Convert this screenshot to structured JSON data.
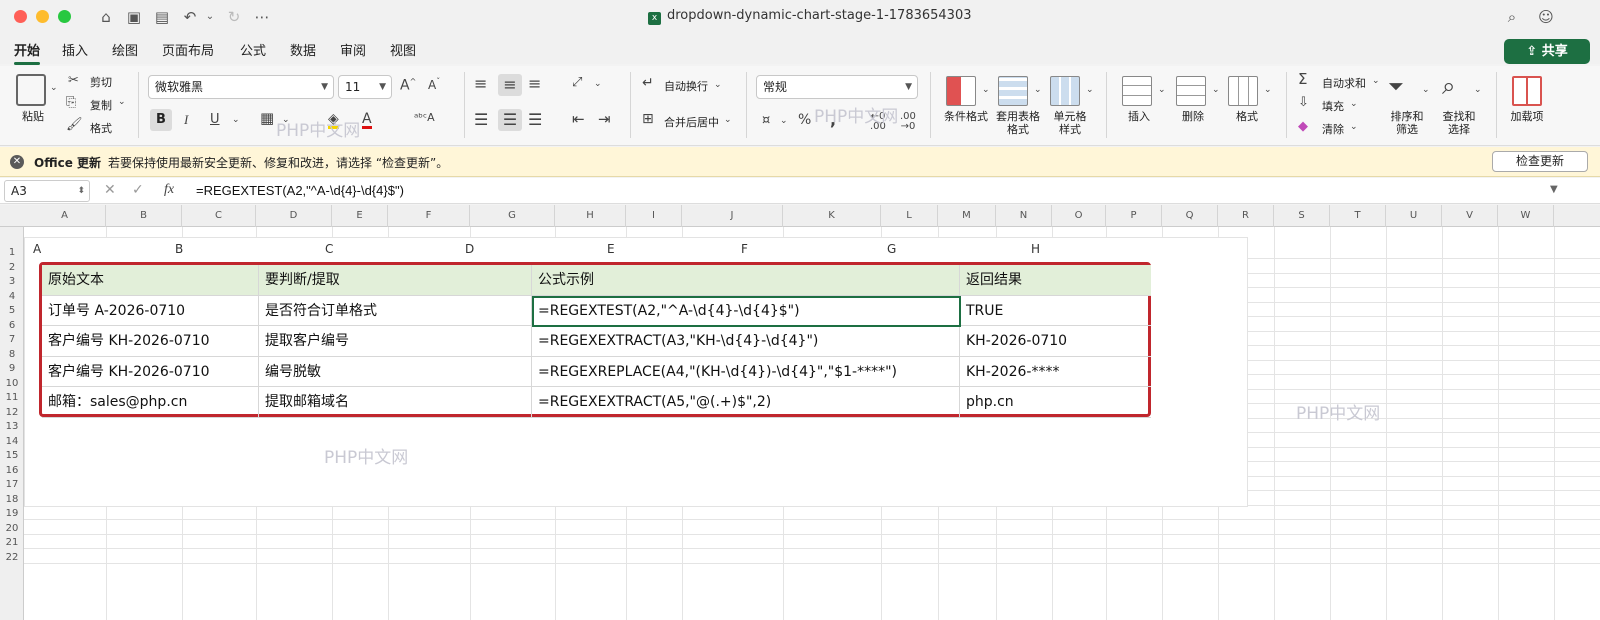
{
  "window": {
    "title": "dropdown-dynamic-chart-stage-1-1783654303"
  },
  "tabs": [
    "开始",
    "插入",
    "绘图",
    "页面布局",
    "公式",
    "数据",
    "审阅",
    "视图"
  ],
  "share_label": "共享",
  "ribbon": {
    "paste": "粘贴",
    "cut": "剪切",
    "copy": "复制",
    "format_painter": "格式",
    "font_name": "微软雅黑",
    "font_size": "11",
    "bold": "B",
    "italic": "I",
    "underline": "U",
    "wrap_text": "自动换行",
    "merge_center": "合并后居中",
    "number_format": "常规",
    "conditional_format": "条件格式",
    "format_as_table": "套用表格\n格式",
    "cell_styles": "单元格\n样式",
    "insert": "插入",
    "delete": "删除",
    "format": "格式",
    "autosum": "自动求和",
    "fill": "填充",
    "clear": "清除",
    "sort_filter": "排序和\n筛选",
    "find_select": "查找和\n选择",
    "addins": "加载项"
  },
  "message_bar": {
    "title": "Office 更新",
    "text": "若要保持使用最新安全更新、修复和改进，请选择 “检查更新”。",
    "button": "检查更新"
  },
  "formula_bar": {
    "cell_ref": "A3",
    "formula": "=REGEXTEST(A2,\"^A-\\d{4}-\\d{4}$\")"
  },
  "columns": [
    "A",
    "B",
    "C",
    "D",
    "E",
    "F",
    "G",
    "H",
    "I",
    "J",
    "K",
    "L",
    "M",
    "N",
    "O",
    "P",
    "Q",
    "R",
    "S",
    "T",
    "U",
    "V",
    "W"
  ],
  "rows": [
    "1",
    "2",
    "3",
    "4",
    "5",
    "6",
    "7",
    "8",
    "9",
    "10",
    "11",
    "12",
    "13",
    "14",
    "15",
    "16",
    "17",
    "18",
    "19",
    "20",
    "21",
    "22"
  ],
  "overlay_columns": [
    "A",
    "B",
    "C",
    "D",
    "E",
    "F",
    "G",
    "H"
  ],
  "table": {
    "headers": [
      "原始文本",
      "要判断/提取",
      "公式示例",
      "返回结果"
    ],
    "rows": [
      [
        "订单号 A-2026-0710",
        "是否符合订单格式",
        "=REGEXTEST(A2,\"^A-\\d{4}-\\d{4}$\")",
        "TRUE"
      ],
      [
        "客户编号 KH-2026-0710",
        "提取客户编号",
        "=REGEXEXTRACT(A3,\"KH-\\d{4}-\\d{4}\")",
        "KH-2026-0710"
      ],
      [
        "客户编号 KH-2026-0710",
        "编号脱敏",
        "=REGEXREPLACE(A4,\"(KH-\\d{4})-\\d{4}\",\"$1-****\")",
        "KH-2026-****"
      ],
      [
        "邮箱：sales@php.cn",
        "提取邮箱域名",
        "=REGEXEXTRACT(A5,\"@(.+)$\",2)",
        "php.cn"
      ]
    ]
  },
  "watermark": "PHP中文网",
  "colors": {
    "accent": "#1d6f42",
    "highlight_border": "#c0262d",
    "header_fill": "#e2efd9",
    "message_bar": "#fff6d8"
  }
}
